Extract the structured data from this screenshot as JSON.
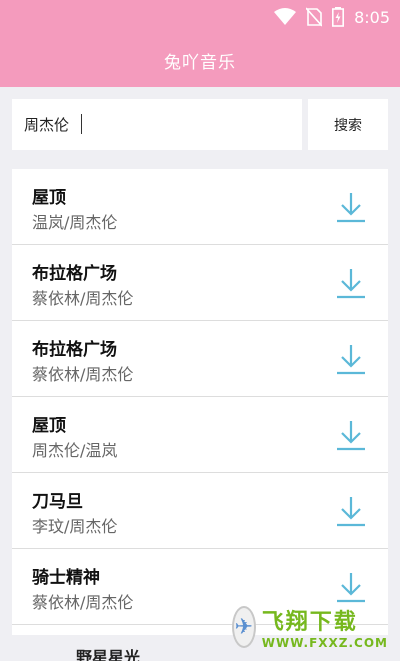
{
  "status": {
    "time": "8:05",
    "icons": [
      "wifi-icon",
      "no-sim-icon",
      "battery-charging-icon"
    ]
  },
  "app": {
    "title": "兔吖音乐"
  },
  "search": {
    "query": "周杰伦",
    "button_label": "搜索"
  },
  "songs": [
    {
      "title": "屋顶",
      "artist": "温岚/周杰伦"
    },
    {
      "title": "布拉格广场",
      "artist": "蔡依林/周杰伦"
    },
    {
      "title": "布拉格广场",
      "artist": "蔡依林/周杰伦"
    },
    {
      "title": "屋顶",
      "artist": "周杰伦/温岚"
    },
    {
      "title": "刀马旦",
      "artist": "李玟/周杰伦"
    },
    {
      "title": "骑士精神",
      "artist": "蔡依林/周杰伦"
    }
  ],
  "bottom_partial": "野星星光",
  "watermark": {
    "main": "飞翔下载",
    "sub": "WWW.FXXZ.COM"
  },
  "colors": {
    "accent": "#f49bbd",
    "download_icon": "#5bb8d8"
  }
}
